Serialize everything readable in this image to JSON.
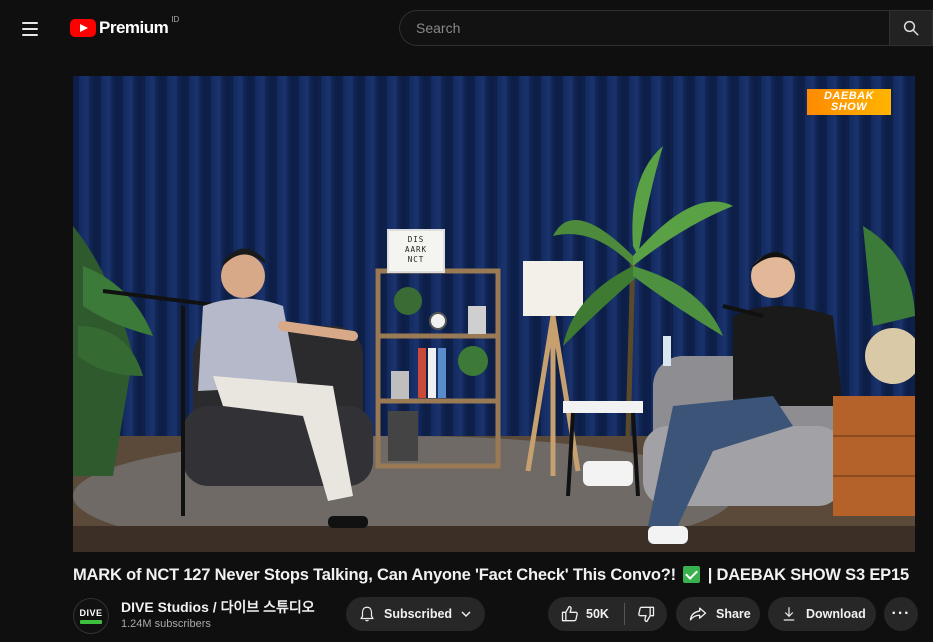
{
  "header": {
    "logo_text": "Premium",
    "logo_region": "ID",
    "search_placeholder": "Search"
  },
  "video": {
    "show_badge_line1": "DAEBAK",
    "show_badge_line2": "SHOW",
    "lightbox_line1": "DIS",
    "lightbox_line2": "AARK",
    "lightbox_line3": "NCT",
    "title_part1": "MARK of NCT 127 Never Stops Talking, Can Anyone 'Fact Check' This Convo?!",
    "title_part2": "| DAEBAK SHOW S3 EP15"
  },
  "channel": {
    "avatar_text": "DIVE",
    "name": "DIVE Studios / 다이브 스튜디오",
    "subscribers": "1.24M subscribers"
  },
  "actions": {
    "subscribe_label": "Subscribed",
    "like_count": "50K",
    "share_label": "Share",
    "download_label": "Download",
    "more_label": "···"
  },
  "colors": {
    "accent_red": "#ff0000",
    "check_green": "#37b24d",
    "pill_bg": "#272727",
    "page_bg": "#0f0f0f"
  }
}
